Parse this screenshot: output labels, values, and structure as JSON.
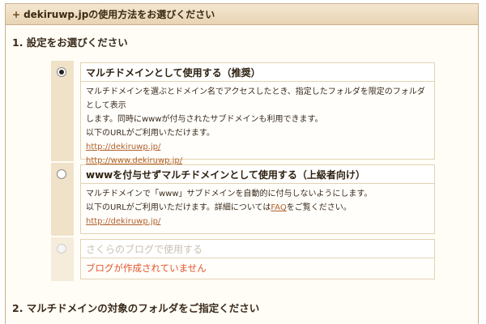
{
  "header": {
    "title": "dekiruwp.jpの使用方法をお選びください"
  },
  "section1": {
    "title": "1. 設定をお選びください"
  },
  "options": [
    {
      "title": "マルチドメインとして使用する（推奨）",
      "desc1": "マルチドメインを選ぶとドメイン名でアクセスしたとき、指定したフォルダを限定のフォルダとして表示",
      "desc2": "します。同時にwwwが付与されたサブドメインも利用できます。",
      "desc3": "以下のURLがご利用いただけます。",
      "url1": "http://dekiruwp.jp/",
      "url2": "http://www.dekiruwp.jp/",
      "checked": true
    },
    {
      "title": "wwwを付与せずマルチドメインとして使用する（上級者向け）",
      "desc1": "マルチドメインで「www」サブドメインを自動的に付与しないようにします。",
      "desc2_pre": "以下のURLがご利用いただけます。詳細については",
      "faq": "FAQ",
      "desc2_post": "をご覧ください。",
      "url1": "http://dekiruwp.jp/",
      "checked": false
    },
    {
      "title": "さくらのブログで使用する",
      "error": "ブログが作成されていません",
      "disabled": true
    }
  ],
  "section2": {
    "title": "2. マルチドメインの対象のフォルダをご指定ください"
  }
}
